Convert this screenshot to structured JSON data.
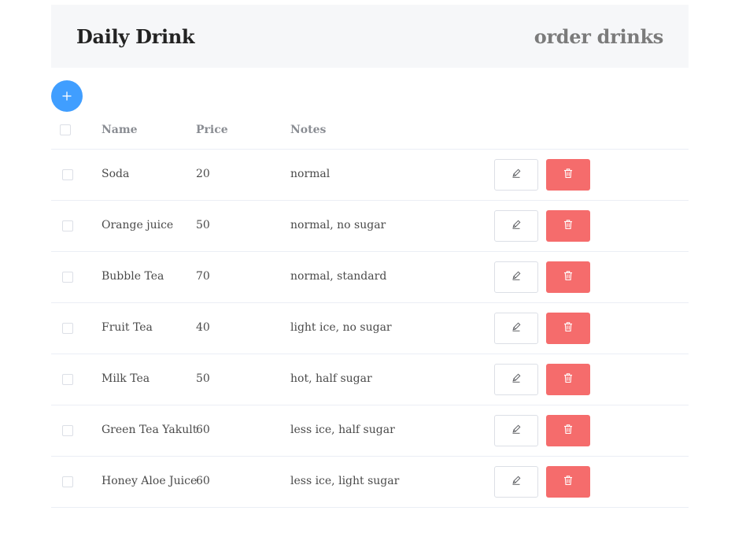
{
  "header": {
    "brand": "Daily Drink",
    "nav_link": "order drinks"
  },
  "add_button": {
    "icon": "plus-icon",
    "color": "#409eff"
  },
  "table": {
    "columns": [
      "Name",
      "Price",
      "Notes"
    ],
    "rows": [
      {
        "name": "Soda",
        "price": "20",
        "notes": "normal"
      },
      {
        "name": "Orange juice",
        "price": "50",
        "notes": "normal, no sugar"
      },
      {
        "name": "Bubble Tea",
        "price": "70",
        "notes": "normal, standard"
      },
      {
        "name": "Fruit Tea",
        "price": "40",
        "notes": "light ice, no sugar"
      },
      {
        "name": "Milk Tea",
        "price": "50",
        "notes": "hot, half sugar"
      },
      {
        "name": "Green Tea Yakult",
        "price": "60",
        "notes": "less ice, half sugar"
      },
      {
        "name": "Honey Aloe Juice",
        "price": "60",
        "notes": "less ice, light sugar"
      }
    ],
    "row_actions": {
      "edit_icon": "pencil-icon",
      "delete_icon": "trash-icon",
      "delete_color": "#f56c6c"
    }
  }
}
